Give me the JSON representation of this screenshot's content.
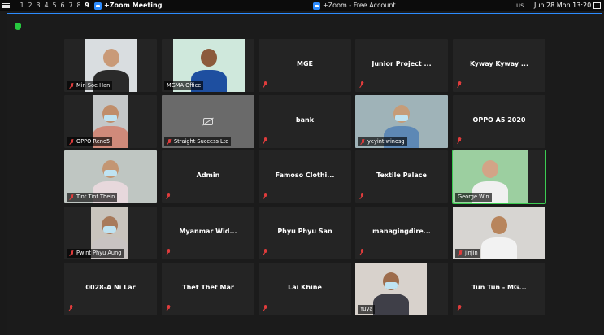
{
  "topbar": {
    "workspaces": [
      "1",
      "2",
      "3",
      "4",
      "5",
      "6",
      "7",
      "8",
      "9"
    ],
    "active_workspace": "9",
    "app_title": "+Zoom Meeting",
    "center_title": "+Zoom - Free Account",
    "keyboard_layout": "us",
    "clock": "Jun 28 Mon 13:20"
  },
  "colors": {
    "accent": "#2d8cff",
    "active_speaker": "#3ccc52",
    "muted_mic": "#e03c3c",
    "tile_bg": "#242424"
  },
  "participants": [
    {
      "name": "Min Soe Han",
      "video": true,
      "muted": true
    },
    {
      "name": "MGMA Office",
      "video": true,
      "muted": false
    },
    {
      "name": "MGE",
      "video": false,
      "muted": true
    },
    {
      "name": "Junior Project ...",
      "video": false,
      "muted": true
    },
    {
      "name": "Kyway Kyway ...",
      "video": false,
      "muted": true
    },
    {
      "name": "OPPO Reno5",
      "video": true,
      "muted": true
    },
    {
      "name": "Straight Success Ltd",
      "video": "off",
      "muted": true
    },
    {
      "name": "bank",
      "video": false,
      "muted": true
    },
    {
      "name": "yeyint winosg",
      "video": true,
      "muted": true
    },
    {
      "name": "OPPO A5 2020",
      "video": false,
      "muted": true
    },
    {
      "name": "Tint Tint Thein",
      "video": true,
      "muted": true
    },
    {
      "name": "Admin",
      "video": false,
      "muted": true
    },
    {
      "name": "Famoso Clothi...",
      "video": false,
      "muted": true
    },
    {
      "name": "Textile Palace",
      "video": false,
      "muted": true
    },
    {
      "name": "George Win",
      "video": true,
      "muted": false,
      "active": true
    },
    {
      "name": "Pwint Phyu Aung",
      "video": true,
      "muted": true
    },
    {
      "name": "Myanmar Wid...",
      "video": false,
      "muted": true
    },
    {
      "name": "Phyu Phyu San",
      "video": false,
      "muted": true
    },
    {
      "name": "managingdire...",
      "video": false,
      "muted": true
    },
    {
      "name": "jinjin",
      "video": true,
      "muted": true
    },
    {
      "name": "0028-A Ni Lar",
      "video": false,
      "muted": true
    },
    {
      "name": "Thet Thet Mar",
      "video": false,
      "muted": true
    },
    {
      "name": "Lai Khine",
      "video": false,
      "muted": true
    },
    {
      "name": "Yuya",
      "video": true,
      "muted": false
    },
    {
      "name": "Tun Tun - MG...",
      "video": false,
      "muted": true
    }
  ]
}
